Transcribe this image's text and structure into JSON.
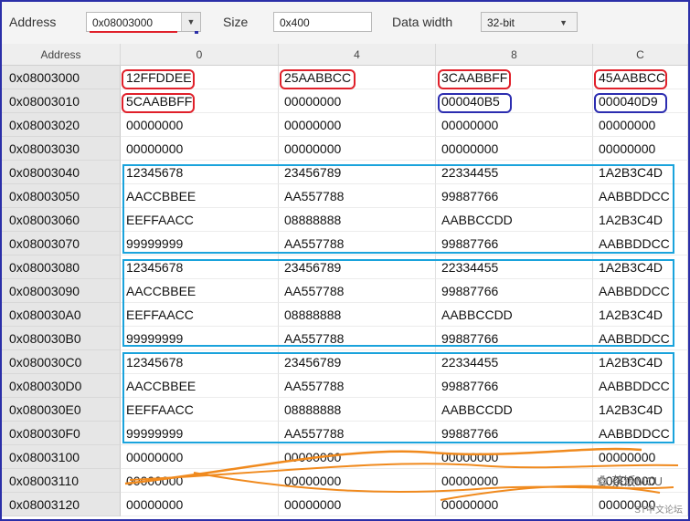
{
  "toolbar": {
    "address_label": "Address",
    "address_value": "0x08003000",
    "size_label": "Size",
    "size_value": "0x400",
    "width_label": "Data width",
    "width_value": "32-bit"
  },
  "grid": {
    "columns": [
      "Address",
      "0",
      "4",
      "8",
      "C"
    ],
    "rows": [
      {
        "addr": "0x08003000",
        "cells": [
          "12FFDDEE",
          "25AABBCC",
          "3CAABBFF",
          "45AABBCC"
        ]
      },
      {
        "addr": "0x08003010",
        "cells": [
          "5CAABBFF",
          "00000000",
          "000040B5",
          "000040D9"
        ]
      },
      {
        "addr": "0x08003020",
        "cells": [
          "00000000",
          "00000000",
          "00000000",
          "00000000"
        ]
      },
      {
        "addr": "0x08003030",
        "cells": [
          "00000000",
          "00000000",
          "00000000",
          "00000000"
        ]
      },
      {
        "addr": "0x08003040",
        "cells": [
          "12345678",
          "23456789",
          "22334455",
          "1A2B3C4D"
        ]
      },
      {
        "addr": "0x08003050",
        "cells": [
          "AACCBBEE",
          "AA557788",
          "99887766",
          "AABBDDCC"
        ]
      },
      {
        "addr": "0x08003060",
        "cells": [
          "EEFFAACC",
          "08888888",
          "AABBCCDD",
          "1A2B3C4D"
        ]
      },
      {
        "addr": "0x08003070",
        "cells": [
          "99999999",
          "AA557788",
          "99887766",
          "AABBDDCC"
        ]
      },
      {
        "addr": "0x08003080",
        "cells": [
          "12345678",
          "23456789",
          "22334455",
          "1A2B3C4D"
        ]
      },
      {
        "addr": "0x08003090",
        "cells": [
          "AACCBBEE",
          "AA557788",
          "99887766",
          "AABBDDCC"
        ]
      },
      {
        "addr": "0x080030A0",
        "cells": [
          "EEFFAACC",
          "08888888",
          "AABBCCDD",
          "1A2B3C4D"
        ]
      },
      {
        "addr": "0x080030B0",
        "cells": [
          "99999999",
          "AA557788",
          "99887766",
          "AABBDDCC"
        ]
      },
      {
        "addr": "0x080030C0",
        "cells": [
          "12345678",
          "23456789",
          "22334455",
          "1A2B3C4D"
        ]
      },
      {
        "addr": "0x080030D0",
        "cells": [
          "AACCBBEE",
          "AA557788",
          "99887766",
          "AABBDDCC"
        ]
      },
      {
        "addr": "0x080030E0",
        "cells": [
          "EEFFAACC",
          "08888888",
          "AABBCCDD",
          "1A2B3C4D"
        ]
      },
      {
        "addr": "0x080030F0",
        "cells": [
          "99999999",
          "AA557788",
          "99887766",
          "AABBDDCC"
        ]
      },
      {
        "addr": "0x08003100",
        "cells": [
          "00000000",
          "00000000",
          "00000000",
          "00000000"
        ]
      },
      {
        "addr": "0x08003110",
        "cells": [
          "00000000",
          "00000000",
          "00000000",
          "00000000"
        ]
      },
      {
        "addr": "0x08003120",
        "cells": [
          "00000000",
          "00000000",
          "00000000",
          "00000000"
        ]
      }
    ]
  },
  "watermark": {
    "text": "茶饭MCU",
    "sub": "ST中文论坛"
  },
  "colors": {
    "red_highlight": "#e0202a",
    "blue_highlight": "#2c2db0",
    "cyan_highlight": "#1aa3dc",
    "orange_scribble": "#f08a1e"
  }
}
